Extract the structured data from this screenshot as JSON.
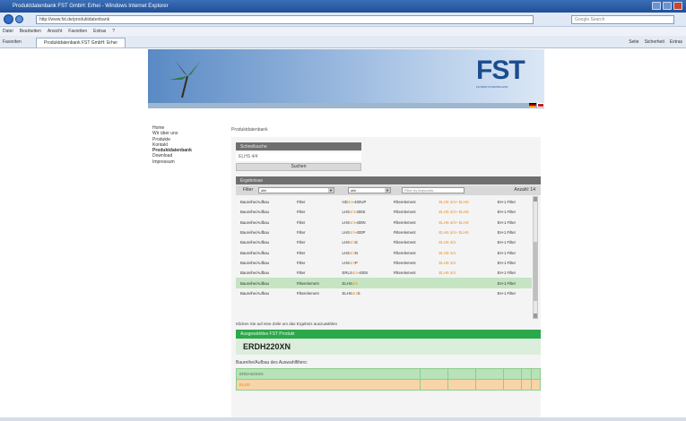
{
  "browser": {
    "title": "Produktdatenbank FST GmbH: Erhei - Windows Internet Explorer",
    "url": "http://www.fst.de/produktdatenbank",
    "search_placeholder": "Google Search",
    "menu": [
      "Datei",
      "Bearbeiten",
      "Ansicht",
      "Favoriten",
      "Extras",
      "?"
    ],
    "favorites_label": "Favoriten",
    "tab_label": "Produktdatenbank FST GmbH: Erhei",
    "cmd_items": [
      "Seite",
      "Sicherheit",
      "Extras"
    ]
  },
  "site": {
    "logo_text": "FST",
    "logo_sub": "FILTERSYSTEMTECHNIK",
    "nav": [
      "Home",
      "Wir über uns",
      "Produkte",
      "Kontakt",
      "Produktdatenbank",
      "Download",
      "Impressum"
    ],
    "nav_active_index": 4,
    "breadcrumb": "Produktdatenbank"
  },
  "quicksearch": {
    "title": "Schnellsuche",
    "input_value": "ELHS 4/4",
    "button_label": "Suchen"
  },
  "results": {
    "title": "Ergebnisse",
    "filter_label": "Filter",
    "select1_value": "alle",
    "select2_value": "alle",
    "filter_placeholder": "Filter by keywords",
    "count_label": "Anzahl: 14",
    "rows": [
      {
        "c1": "Baureihe/Aufbau",
        "c2": "Filter",
        "c3a": "HD",
        "c3b": "4/4",
        "c3c": "-400UP",
        "c4": "Filterelement",
        "c5a": "ELHS",
        "c5b": "4/4",
        "c5c": "+ ELHS",
        "c6": "EH-1 Filter",
        "hl": false
      },
      {
        "c1": "Baureihe/Aufbau",
        "c2": "Filter",
        "c3a": "LHS",
        "c3b": "4/4",
        "c3c": "-400S",
        "c4": "Filterelement",
        "c5a": "ELHS",
        "c5b": "4/4",
        "c5c": "+ ELHS",
        "c6": "EH-1 Filter",
        "hl": false
      },
      {
        "c1": "Baureihe/Aufbau",
        "c2": "Filter",
        "c3a": "LHS",
        "c3b": "4/4",
        "c3c": "-400N",
        "c4": "Filterelement",
        "c5a": "ELHS",
        "c5b": "4/4",
        "c5c": "+ ELHS",
        "c6": "EH-1 Filter",
        "hl": false
      },
      {
        "c1": "Baureihe/Aufbau",
        "c2": "Filter",
        "c3a": "LHS",
        "c3b": "4/4",
        "c3c": "-400P",
        "c4": "Filterelement",
        "c5a": "ELHS",
        "c5b": "4/4",
        "c5c": "+ ELHS",
        "c6": "EH-1 Filter",
        "hl": false
      },
      {
        "c1": "Baureihe/Aufbau",
        "c2": "Filter",
        "c3a": "LHS",
        "c3b": "4/4",
        "c3c": "S",
        "c4": "Filterelement",
        "c5a": "ELHS",
        "c5b": "4/4",
        "c5c": "",
        "c6": "EH-1 Filter",
        "hl": false
      },
      {
        "c1": "Baureihe/Aufbau",
        "c2": "Filter",
        "c3a": "LHS",
        "c3b": "4/4",
        "c3c": "N",
        "c4": "Filterelement",
        "c5a": "ELHS",
        "c5b": "4/4",
        "c5c": "",
        "c6": "EH-1 Filter",
        "hl": false
      },
      {
        "c1": "Baureihe/Aufbau",
        "c2": "Filter",
        "c3a": "LHS",
        "c3b": "4/4",
        "c3c": "P",
        "c4": "Filterelement",
        "c5a": "ELHS",
        "c5b": "4/4",
        "c5c": "",
        "c6": "EH-1 Filter",
        "hl": false
      },
      {
        "c1": "Baureihe/Aufbau",
        "c2": "Filter",
        "c3a": "ERLS",
        "c3b": "4/4",
        "c3c": "-400S",
        "c4": "Filterelement",
        "c5a": "ELHS",
        "c5b": "4/4",
        "c5c": "",
        "c6": "EH-1 Filter",
        "hl": false
      },
      {
        "c1": "Baureihe/Aufbau",
        "c2": "Filterelement",
        "c3a": "ELHS",
        "c3b": "4/4",
        "c3c": "",
        "c4": "",
        "c5a": "",
        "c5b": "",
        "c5c": "",
        "c6": "EH-1 Filter",
        "hl": true
      },
      {
        "c1": "Baureihe/Aufbau",
        "c2": "Filterelement",
        "c3a": "ELHS",
        "c3b": "4/4",
        "c3c": "S",
        "c4": "",
        "c5a": "",
        "c5b": "",
        "c5c": "",
        "c6": "EH-1 Filter",
        "hl": false
      }
    ],
    "notice": "Klicken Sie auf eine Zeile um das Ergebnis auszuwählen"
  },
  "selection": {
    "header": "Ausgewähltes FST Produkt",
    "product": "ERDH220XN",
    "reihe_label": "Baureihe/Aufbau des Auswahlfilters:",
    "rows": [
      {
        "cells": [
          "ERDH220XN",
          "",
          "",
          "",
          "",
          "",
          ""
        ]
      },
      {
        "cells": [
          "ELHS",
          "",
          "",
          "",
          "",
          "",
          ""
        ]
      }
    ]
  },
  "colors": {
    "accent_orange": "#e58a19",
    "highlight_green": "#c5e4c2",
    "selection_green": "#2aa84a",
    "dark_bar": "#6f6f6f"
  }
}
